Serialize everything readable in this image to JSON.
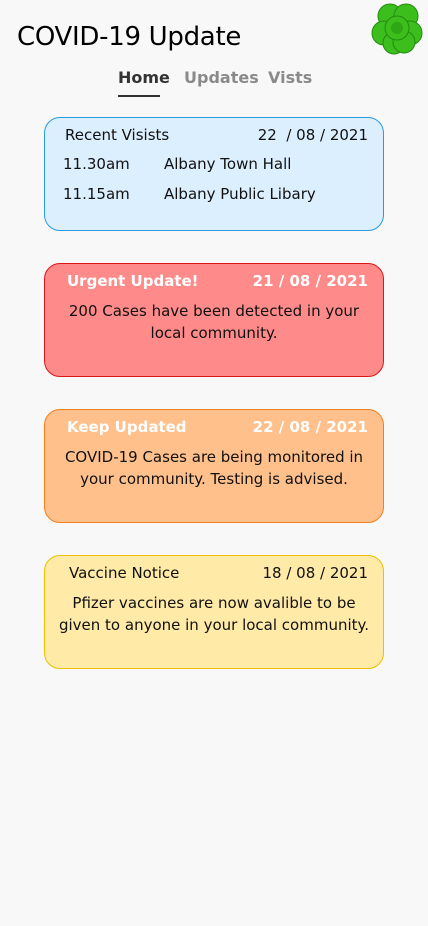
{
  "header": {
    "title": "COVID-19 Update",
    "logo_icon": "four-leaf-clover-icon"
  },
  "tabs": [
    {
      "label": "Home",
      "active": true
    },
    {
      "label": "Updates",
      "active": false
    },
    {
      "label": "Vists",
      "active": false
    }
  ],
  "visits": {
    "title": "Recent Visists",
    "date": "22  / 08 / 2021",
    "rows": [
      {
        "time": "11.30am",
        "place": "Albany Town Hall"
      },
      {
        "time": "11.15am",
        "place": "Albany Public Libary"
      }
    ]
  },
  "urgent": {
    "title": "Urgent Update!",
    "date": "21 / 08 / 2021",
    "body": "200 Cases have been detected in your local community."
  },
  "keep": {
    "title": "Keep Updated",
    "date": "22 / 08 / 2021",
    "body": "COVID-19 Cases are being monitored in your community. Testing is advised."
  },
  "vaccine": {
    "title": "Vaccine Notice",
    "date": "18 / 08 / 2021",
    "body": "Pfizer vaccines are now avalible to be given to anyone in your local community."
  },
  "colors": {
    "visits_bg": "#dcefff",
    "urgent_bg": "#ff8a8a",
    "keep_bg": "#ffc08c",
    "vaccine_bg": "#ffeaa8",
    "logo_green": "#3cbf1c"
  }
}
